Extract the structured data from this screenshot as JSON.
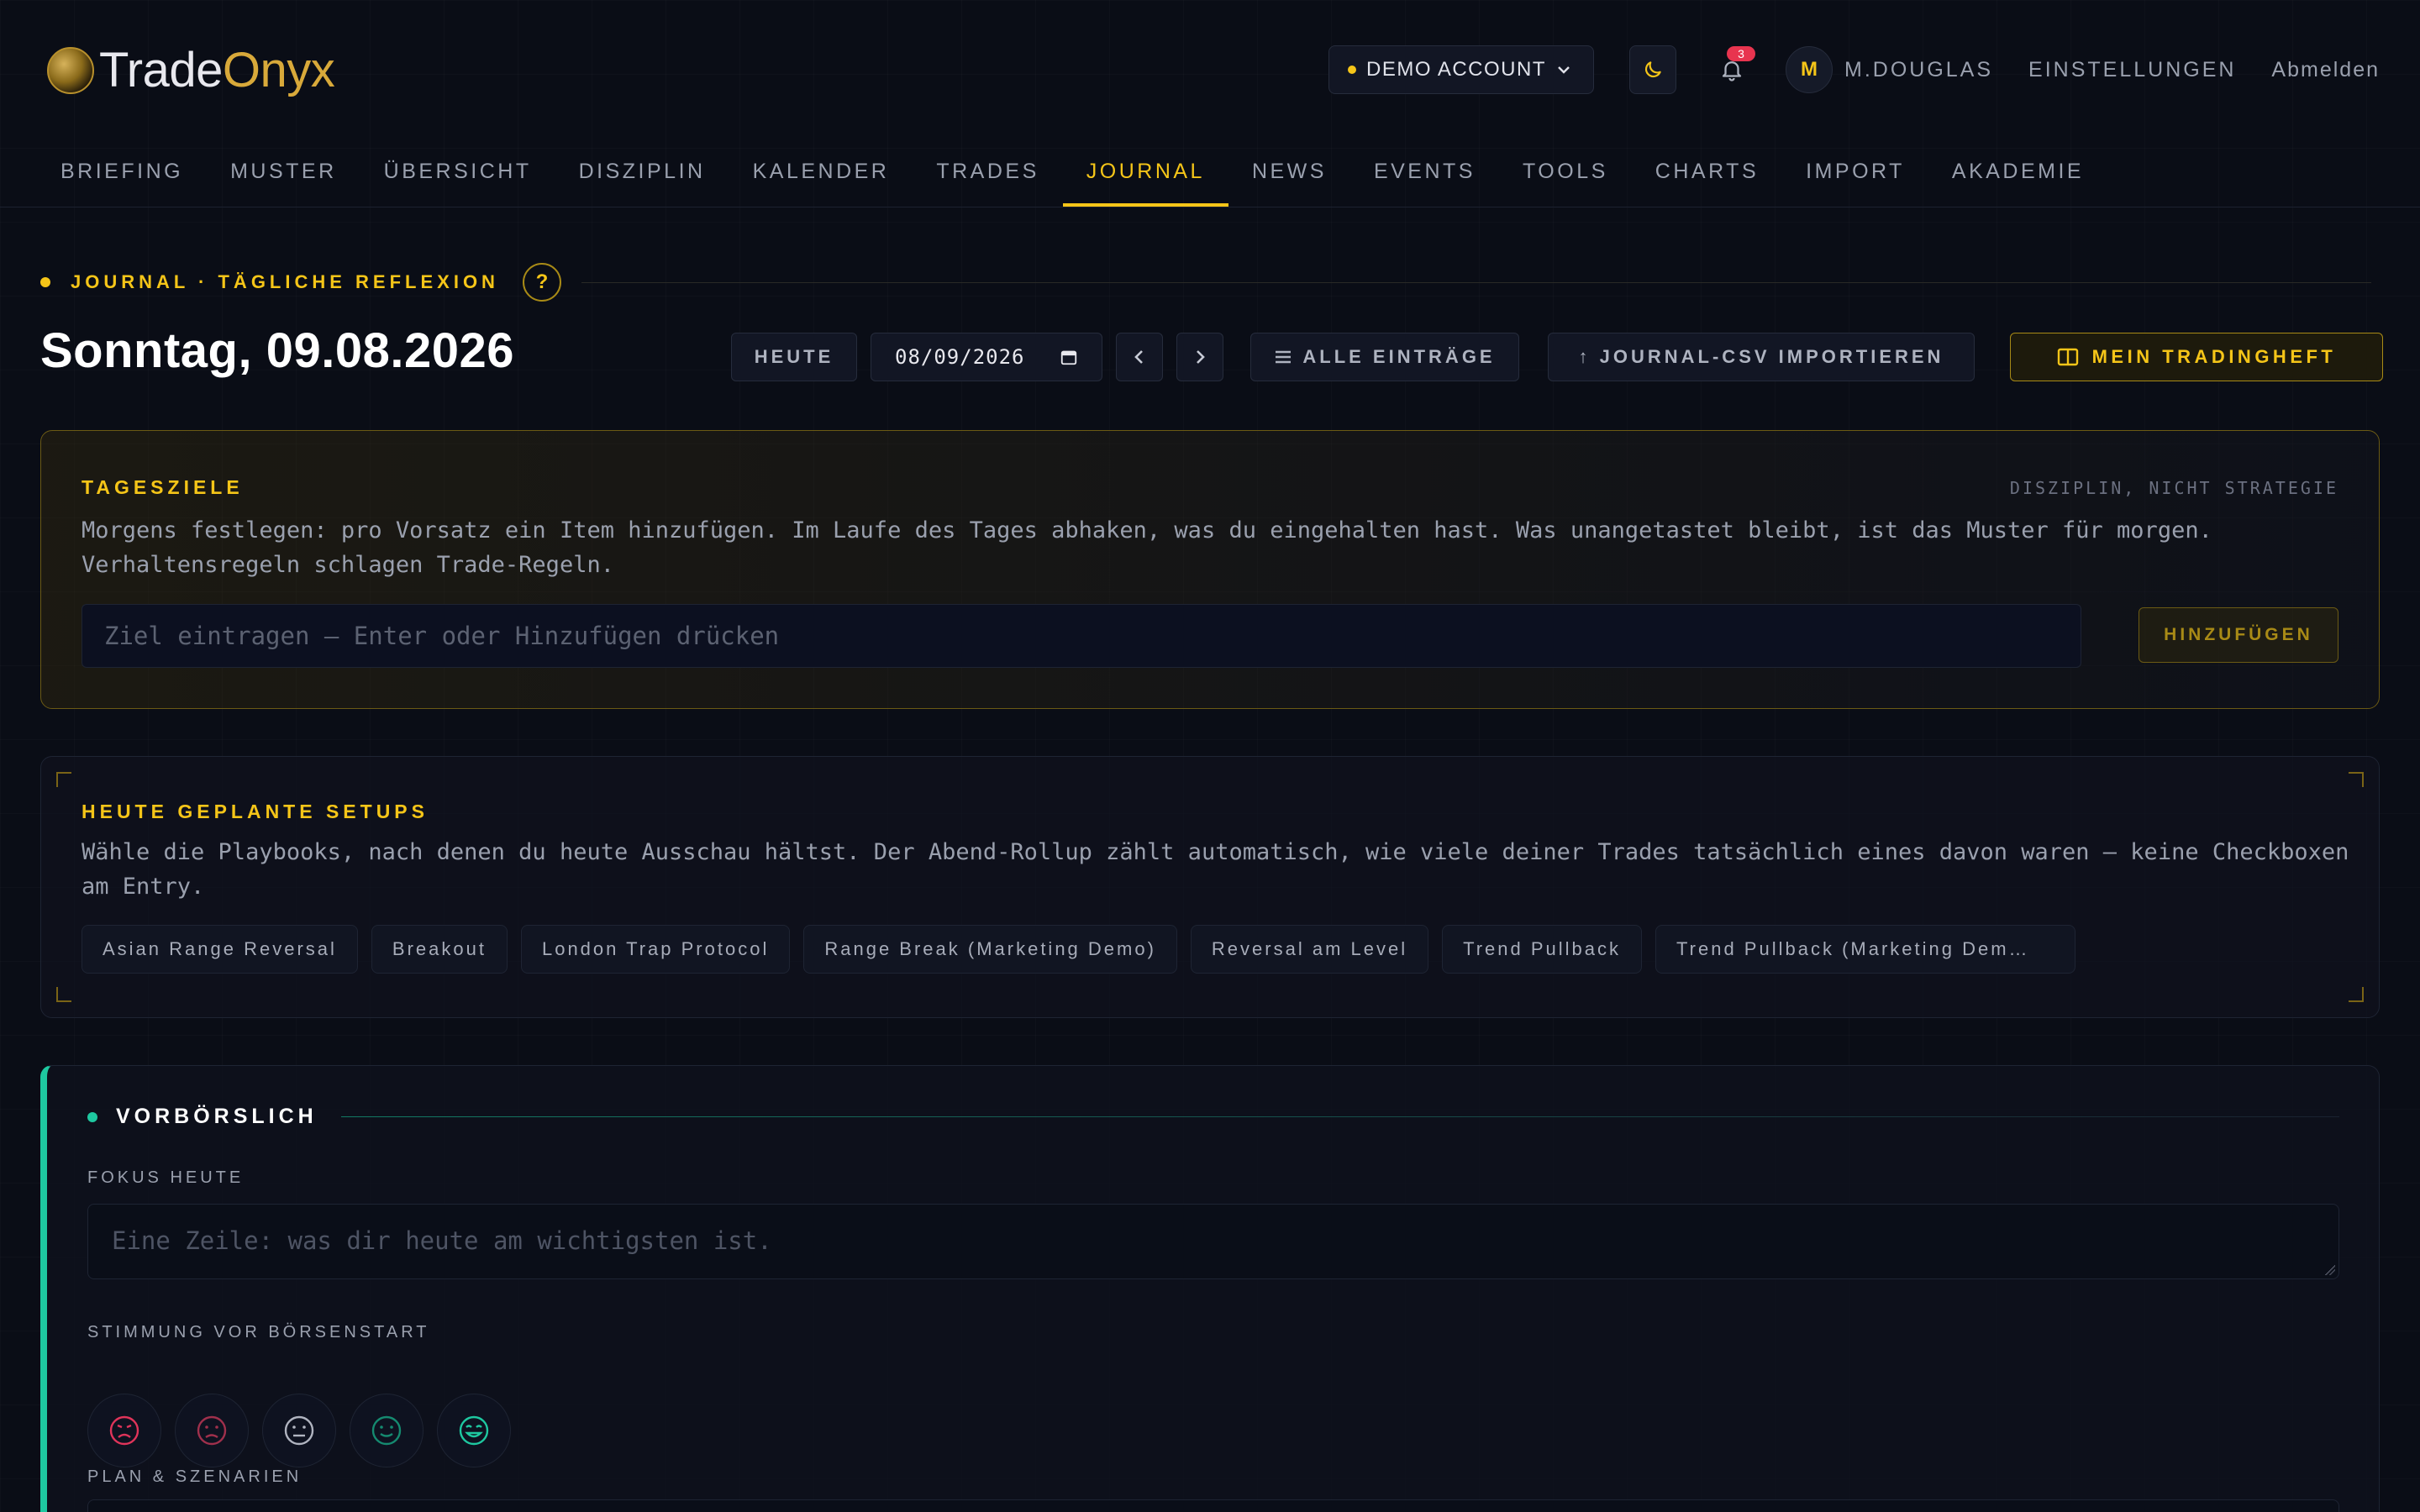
{
  "brand": {
    "name_part1": "Trade",
    "name_part2": "Onyx"
  },
  "header": {
    "account": "DEMO ACCOUNT",
    "notifications_count": "3",
    "avatar_initial": "M",
    "username": "M.DOUGLAS",
    "settings": "EINSTELLUNGEN",
    "logout": "Abmelden"
  },
  "nav": {
    "tabs": [
      "BRIEFING",
      "MUSTER",
      "ÜBERSICHT",
      "DISZIPLIN",
      "KALENDER",
      "TRADES",
      "JOURNAL",
      "NEWS",
      "EVENTS",
      "TOOLS",
      "CHARTS",
      "IMPORT",
      "AKADEMIE"
    ],
    "active": "JOURNAL"
  },
  "page": {
    "eyebrow": "JOURNAL · TÄGLICHE REFLEXION",
    "help": "?",
    "title": "Sonntag, 09.08.2026"
  },
  "toolbar": {
    "today": "HEUTE",
    "date_value": "08/09/2026",
    "all_entries": "ALLE EINTRÄGE",
    "import_csv": "↑ JOURNAL-CSV IMPORTIEREN",
    "tradingheft": "MEIN TRADINGHEFT"
  },
  "goals": {
    "title": "TAGESZIELE",
    "meta": "DISZIPLIN, NICHT STRATEGIE",
    "line1": "Morgens festlegen: pro Vorsatz ein Item hinzufügen. Im Laufe des Tages abhaken, was du eingehalten hast. Was unangetastet bleibt, ist das Muster für morgen.",
    "line2": "Verhaltensregeln schlagen Trade-Regeln.",
    "placeholder": "Ziel eintragen — Enter oder Hinzufügen drücken",
    "add_label": "HINZUFÜGEN"
  },
  "setups": {
    "title": "HEUTE GEPLANTE SETUPS",
    "line1": "Wähle die Playbooks, nach denen du heute Ausschau hältst. Der Abend-Rollup zählt automatisch, wie viele deiner Trades tatsächlich eines davon waren — keine Checkboxen",
    "line2": "am Entry.",
    "chips": [
      "Asian Range Reversal",
      "Breakout",
      "London Trap Protocol",
      "Range Break (Marketing Demo)",
      "Reversal am Level",
      "Trend Pullback",
      "Trend Pullback (Marketing Dem…"
    ]
  },
  "premarket": {
    "title": "VORBÖRSLICH",
    "focus_label": "FOKUS HEUTE",
    "focus_placeholder": "Eine Zeile: was dir heute am wichtigsten ist.",
    "mood_label": "STIMMUNG VOR BÖRSENSTART",
    "moods": [
      "angry-face-icon",
      "sad-face-icon",
      "neutral-face-icon",
      "smile-face-icon",
      "happy-face-icon"
    ],
    "plan_label": "PLAN & SZENARIEN"
  },
  "colors": {
    "accent": "#f5c518",
    "teal": "#1ec8a0",
    "red": "#e0345a",
    "bg": "#0a0d16"
  }
}
